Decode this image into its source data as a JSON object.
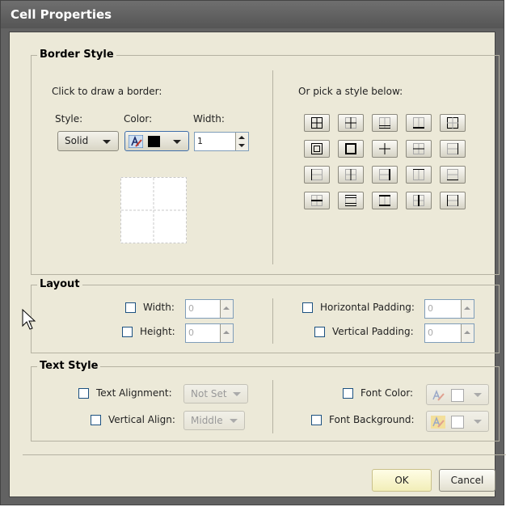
{
  "dialog": {
    "title": "Cell Properties"
  },
  "border_style": {
    "legend": "Border Style",
    "draw_label": "Click to draw a border:",
    "style_label": "Style:",
    "color_label": "Color:",
    "width_label": "Width:",
    "style_value": "Solid",
    "color_value": "#000000",
    "width_value": "1",
    "pick_label": "Or pick a style below:"
  },
  "layout": {
    "legend": "Layout",
    "width_label": "Width:",
    "width_value": "0",
    "height_label": "Height:",
    "height_value": "0",
    "hpad_label": "Horizontal Padding:",
    "hpad_value": "0",
    "vpad_label": "Vertical Padding:",
    "vpad_value": "0"
  },
  "text_style": {
    "legend": "Text Style",
    "align_label": "Text Alignment:",
    "align_value": "Not Set",
    "valign_label": "Vertical Align:",
    "valign_value": "Middle",
    "font_color_label": "Font Color:",
    "font_bg_label": "Font Background:"
  },
  "buttons": {
    "ok": "OK",
    "cancel": "Cancel"
  }
}
